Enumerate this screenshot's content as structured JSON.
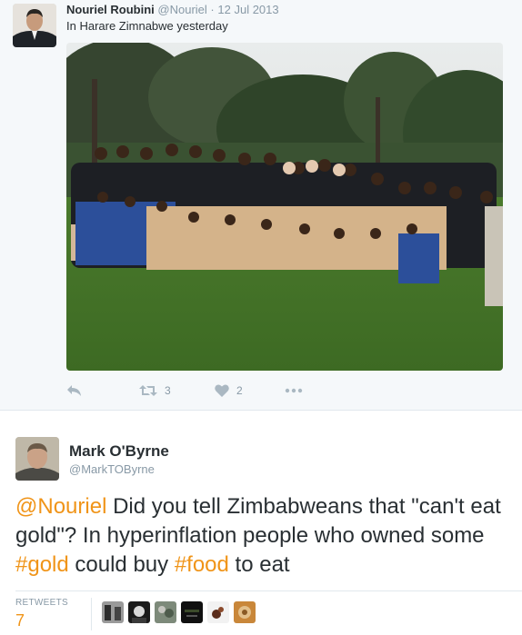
{
  "quoted_tweet": {
    "author_name": "Nouriel Roubini",
    "author_handle": "@Nouriel",
    "separator": "·",
    "date": "12 Jul 2013",
    "text": "In Harare Zimnabwe yesterday",
    "actions": {
      "reply_icon": "reply-icon",
      "retweet_icon": "retweet-icon",
      "retweet_count": "3",
      "like_icon": "heart-icon",
      "like_count": "2",
      "more_icon": "more-icon"
    }
  },
  "tweet": {
    "author_name": "Mark O'Byrne",
    "author_handle": "@MarkTOByrne",
    "text_parts": {
      "mention": "@Nouriel",
      "t1": " Did you tell Zimbabweans that \"can't eat gold\"? In hyperinflation people who owned some ",
      "hashtag_gold": "#gold",
      "t2": " could buy ",
      "hashtag_food": "#food",
      "t3": " to eat"
    },
    "retweets_label": "RETWEETS",
    "retweets_count": "7"
  },
  "colors": {
    "link": "#f09418",
    "secondary_text": "#8899a6",
    "icon": "#aab8c2",
    "quoted_bg": "#f5f8fa"
  }
}
